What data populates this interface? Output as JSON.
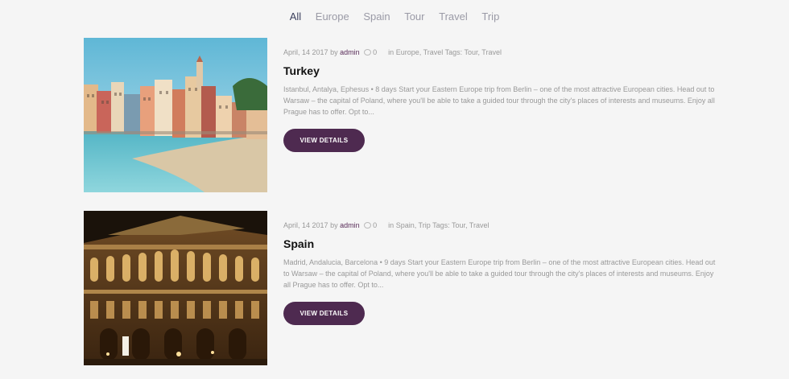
{
  "filters": [
    "All",
    "Europe",
    "Spain",
    "Tour",
    "Travel",
    "Trip"
  ],
  "posts": [
    {
      "date": "April, 14 2017",
      "by": "by",
      "author": "admin",
      "comments": "0",
      "in_label": "in",
      "categories": "Europe, Travel",
      "tags_label": "Tags:",
      "tags": "Tour, Travel",
      "title": "Turkey",
      "excerpt": "Istanbul, Antalya, Ephesus • 8 days Start your Eastern Europe trip from Berlin – one of the most attractive European cities. Head out to Warsaw – the capital of Poland, where you'll be able to take a guided tour through the city's places of interests and museums. Enjoy all Prague has to offer. Opt to...",
      "button": "VIEW DETAILS"
    },
    {
      "date": "April, 14 2017",
      "by": "by",
      "author": "admin",
      "comments": "0",
      "in_label": "in",
      "categories": "Spain, Trip",
      "tags_label": "Tags:",
      "tags": "Tour, Travel",
      "title": "Spain",
      "excerpt": "Madrid, Andalucia, Barcelona • 9 days Start your Eastern Europe trip from Berlin – one of the most attractive European cities. Head out to Warsaw – the capital of Poland, where you'll be able to take a guided tour through the city's places of interests and museums. Enjoy all Prague has to offer. Opt to...",
      "button": "VIEW DETAILS"
    }
  ]
}
